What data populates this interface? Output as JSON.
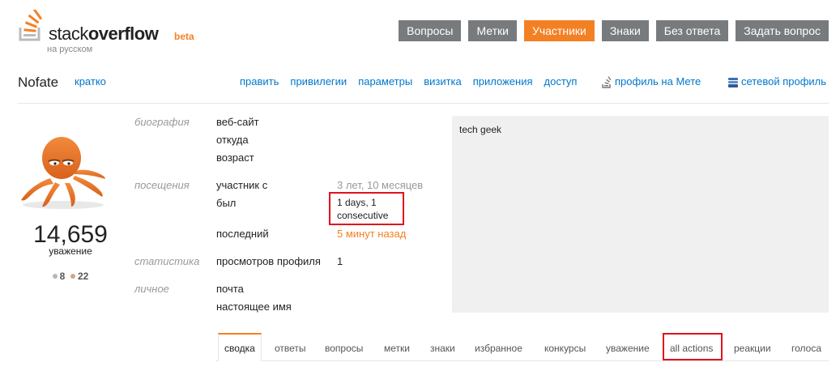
{
  "header": {
    "logo": {
      "text_light": "stack",
      "text_bold": "overflow",
      "beta": "beta",
      "subtitle": "на русском"
    },
    "nav": [
      {
        "label": "Вопросы",
        "active": false
      },
      {
        "label": "Метки",
        "active": false
      },
      {
        "label": "Участники",
        "active": true
      },
      {
        "label": "Знаки",
        "active": false
      },
      {
        "label": "Без ответа",
        "active": false
      },
      {
        "label": "Задать вопрос",
        "active": false
      }
    ]
  },
  "user": {
    "name": "Nofate",
    "brief_link": "кратко",
    "links": [
      "править",
      "привилегии",
      "параметры",
      "визитка",
      "приложения",
      "доступ"
    ],
    "meta_profile": "профиль на Мете",
    "network_profile": "сетевой профиль"
  },
  "card": {
    "reputation": "14,659",
    "reputation_label": "уважение",
    "badges": {
      "silver": "8",
      "bronze": "22"
    }
  },
  "info": {
    "bio_section": "биография",
    "website_label": "веб-сайт",
    "location_label": "откуда",
    "age_label": "возраст",
    "visits_section": "посещения",
    "member_since_label": "участник с",
    "member_since_value": "3 лет, 10 месяцев",
    "visited_label": "был",
    "visited_value_line1": "1 days, 1",
    "visited_value_line2": "consecutive",
    "last_seen_label": "последний",
    "last_seen_value": "5 минут назад",
    "stats_section": "статистика",
    "profile_views_label": "просмотров профиля",
    "profile_views_value": "1",
    "personal_section": "личное",
    "email_label": "почта",
    "real_name_label": "настоящее имя"
  },
  "about": {
    "text": "tech geek"
  },
  "tabs": [
    {
      "label": "сводка",
      "active": true
    },
    {
      "label": "ответы"
    },
    {
      "label": "вопросы"
    },
    {
      "label": "метки"
    },
    {
      "label": "знаки"
    },
    {
      "label": "избранное"
    },
    {
      "label": "конкурсы"
    },
    {
      "label": "уважение"
    },
    {
      "label": "all actions",
      "highlighted": true
    },
    {
      "label": "реакции"
    },
    {
      "label": "голоса"
    }
  ],
  "colors": {
    "accent": "#f48024",
    "link": "#0077cc",
    "nav_bg": "#777b7e",
    "highlight": "#e0131c",
    "silver": "#b4b8bc",
    "bronze": "#d1a684"
  },
  "icons": [
    "stackoverflow-logo-icon",
    "meta-icon",
    "network-icon"
  ]
}
